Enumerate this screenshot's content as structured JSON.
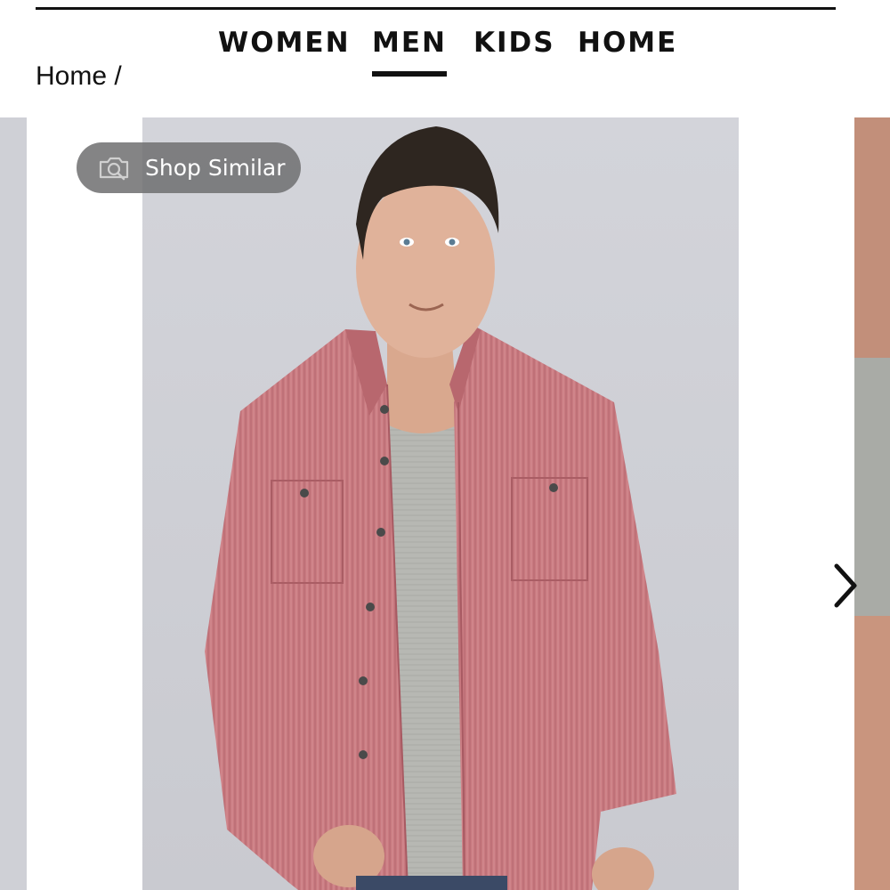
{
  "nav": {
    "items": [
      {
        "label": "WOMEN",
        "active": false
      },
      {
        "label": "MEN",
        "active": true
      },
      {
        "label": "KIDS",
        "active": false
      },
      {
        "label": "HOME",
        "active": false
      }
    ]
  },
  "breadcrumb": {
    "text": "Home /"
  },
  "gallery": {
    "shop_similar_label": "Shop Similar",
    "shop_similar_icon": "camera-search-icon",
    "next_icon": "chevron-right-icon",
    "product_image": "man-in-red-chambray-shirt-over-grey-tee",
    "colors": {
      "shirt": "#c97a80",
      "tee": "#b7b8b3",
      "backdrop": "#cfd0d6"
    }
  }
}
